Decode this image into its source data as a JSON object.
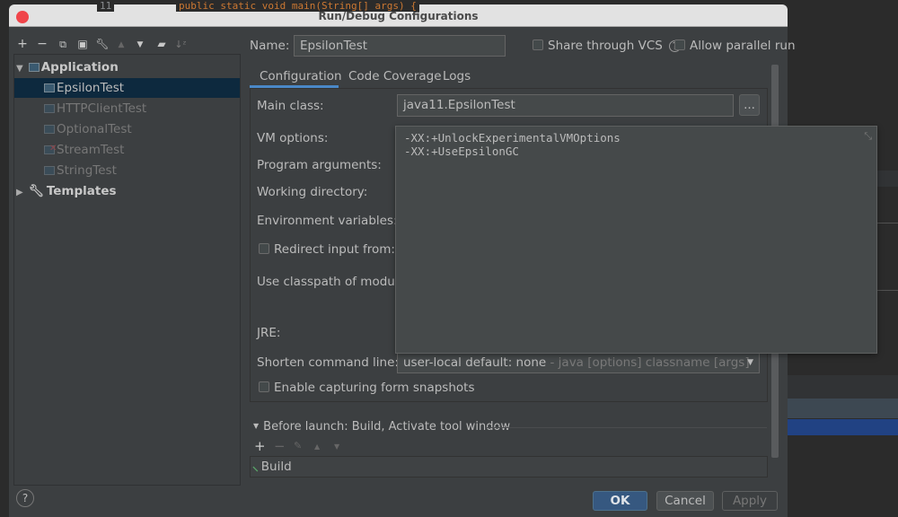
{
  "background_editor": {
    "line_number": "11",
    "code": "public static void main(String[] args) {"
  },
  "dialog": {
    "title": "Run/Debug Configurations"
  },
  "toolbar": {
    "icons": [
      "plus-icon",
      "minus-icon",
      "copy-icon",
      "save-icon",
      "wrench-icon",
      "arrow-up-icon",
      "arrow-down-icon",
      "new-folder-icon",
      "sort-icon"
    ]
  },
  "tree": {
    "application": "Application",
    "items": [
      {
        "label": "EpsilonTest",
        "selected": true
      },
      {
        "label": "HTTPClientTest"
      },
      {
        "label": "OptionalTest"
      },
      {
        "label": "StreamTest",
        "error": true
      },
      {
        "label": "StringTest"
      }
    ],
    "templates": "Templates"
  },
  "name": {
    "label": "Name:",
    "value": "EpsilonTest"
  },
  "share_vcs": {
    "label": "Share through VCS",
    "checked": false
  },
  "parallel": {
    "label": "Allow parallel run",
    "checked": false
  },
  "tabs": [
    "Configuration",
    "Code Coverage",
    "Logs"
  ],
  "form": {
    "main_class_label": "Main class:",
    "main_class_value": "java11.EpsilonTest",
    "browse_label": "...",
    "vm_options_label": "VM options:",
    "vm_options_lines": [
      "-XX:+UnlockExperimentalVMOptions",
      "-XX:+UseEpsilonGC"
    ],
    "program_args_label": "Program arguments:",
    "working_dir_label": "Working directory:",
    "env_label": "Environment variables:",
    "redirect_label": "Redirect input from:",
    "classpath_label": "Use classpath of module:",
    "jre_label": "JRE:",
    "shorten_label": "Shorten command line:",
    "shorten_value": "user-local default: none",
    "shorten_hint": " - java [options] classname [args]",
    "snapshots_label": "Enable capturing form snapshots"
  },
  "before_launch": {
    "title": "Before launch: Build, Activate tool window",
    "items": [
      "Build"
    ]
  },
  "buttons": {
    "help": "?",
    "ok": "OK",
    "cancel": "Cancel",
    "apply": "Apply"
  },
  "colors": {
    "accent": "#4a88c7",
    "ok_button": "#365880",
    "selection": "#0d293e",
    "close": "#f0454a"
  }
}
